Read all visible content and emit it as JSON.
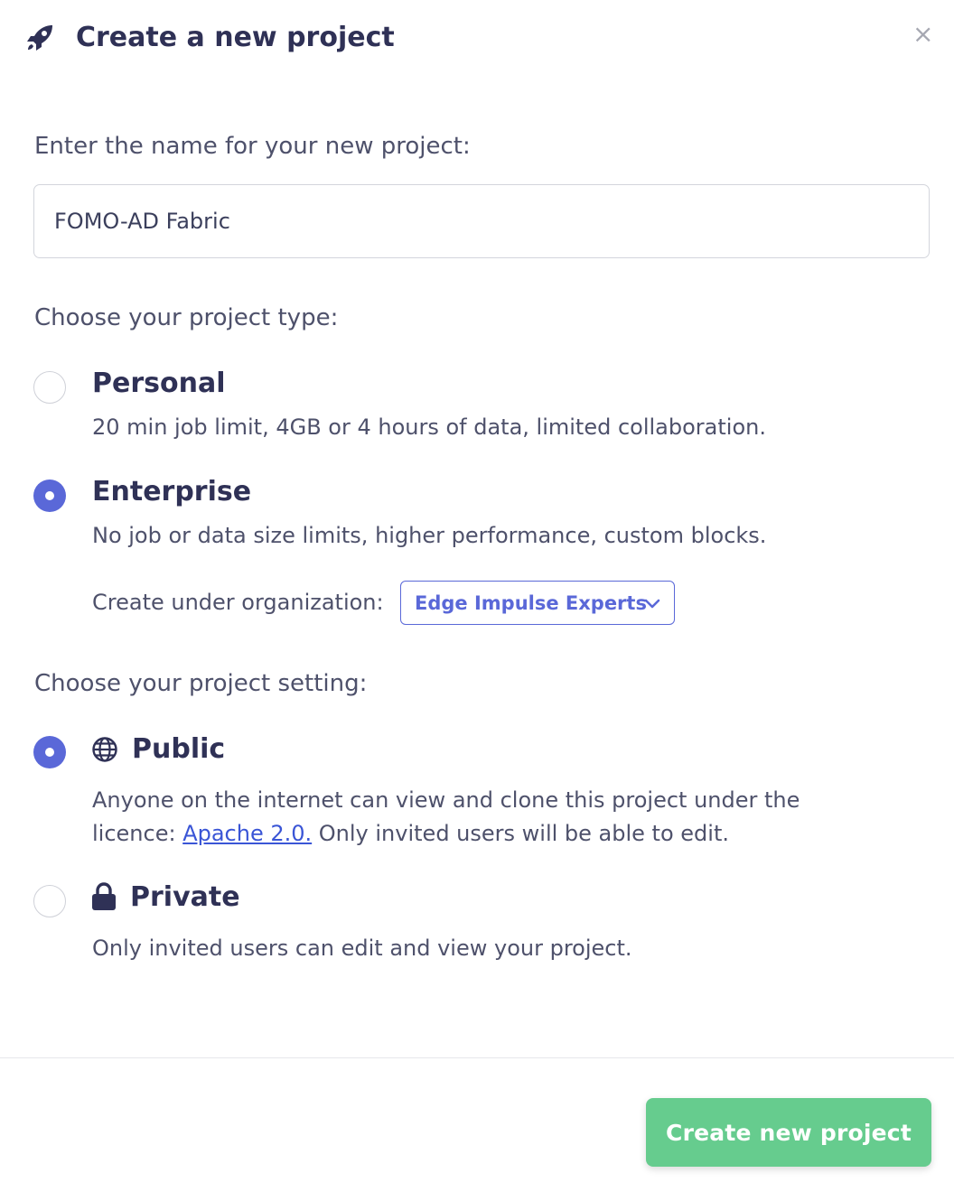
{
  "header": {
    "title": "Create a new project",
    "icon": "rocket-icon",
    "close_icon": "close-icon",
    "close_glyph": "×"
  },
  "name_section": {
    "label": "Enter the name for your new project:",
    "input_value": "FOMO-AD Fabric"
  },
  "project_type": {
    "label": "Choose your project type:",
    "options": [
      {
        "title": "Personal",
        "description": "20 min job limit, 4GB or 4 hours of data, limited collaboration.",
        "selected": false
      },
      {
        "title": "Enterprise",
        "description": "No job or data size limits, higher performance, custom blocks.",
        "selected": true
      }
    ],
    "organization": {
      "label": "Create under organization:",
      "selected": "Edge Impulse Experts"
    }
  },
  "project_setting": {
    "label": "Choose your project setting:",
    "options": [
      {
        "title": "Public",
        "icon": "globe-icon",
        "description_line1": "Anyone on the internet can view and clone this project under the",
        "description_prefix": "licence: ",
        "license_link": "Apache 2.0.",
        "description_suffix": " Only invited users will be able to edit.",
        "selected": true
      },
      {
        "title": "Private",
        "icon": "lock-icon",
        "description": "Only invited users can edit and view your project.",
        "selected": false
      }
    ]
  },
  "footer": {
    "create_button": "Create new project"
  },
  "colors": {
    "accent": "#5a68d8",
    "success_button": "#66cc8e",
    "title_text": "#2f3156",
    "body_text": "#4e516b",
    "link": "#3a55d6"
  }
}
